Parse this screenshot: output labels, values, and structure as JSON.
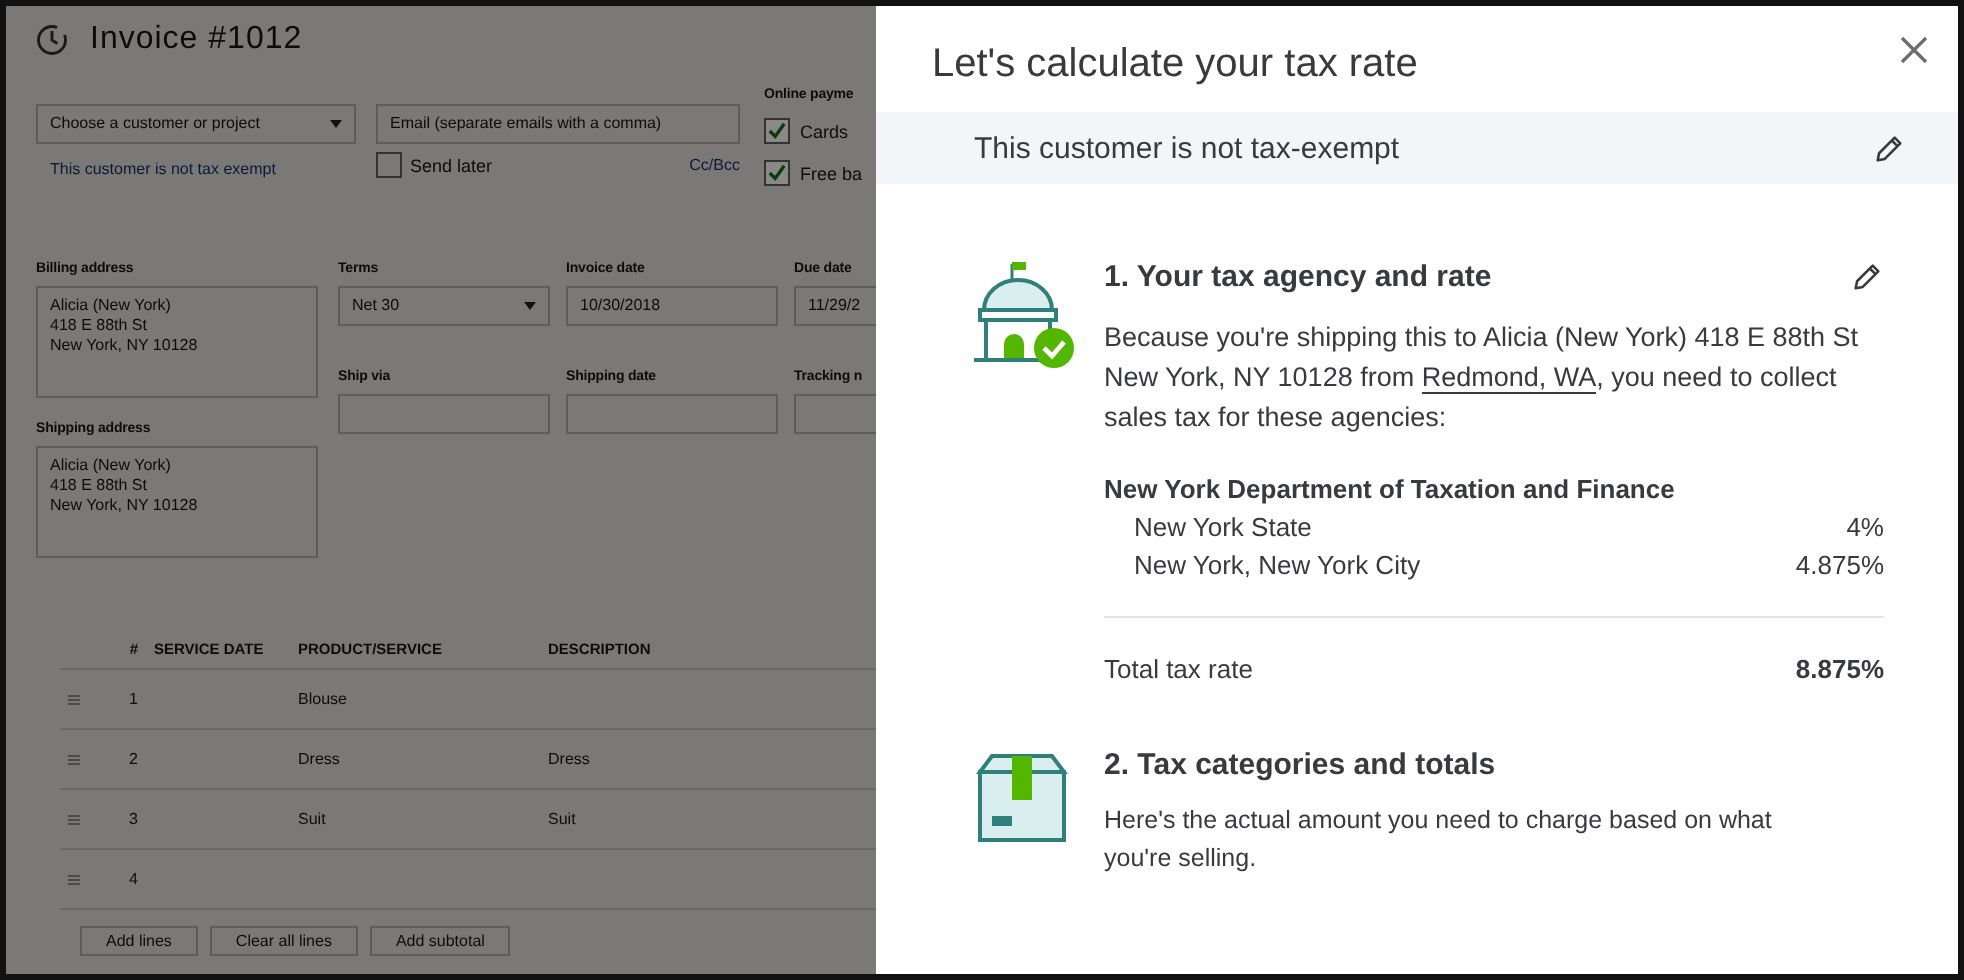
{
  "invoice": {
    "title": "Invoice #1012",
    "customer": {
      "placeholder": "Choose a customer or project"
    },
    "email": {
      "placeholder": "Email (separate emails with a comma)"
    },
    "tax_note": "This customer is not tax exempt",
    "send_later": {
      "label": "Send later",
      "checked": false
    },
    "cc_bcc": "Cc/Bcc",
    "online_payments": {
      "label": "Online payme",
      "options": [
        {
          "label": "Cards",
          "checked": true
        },
        {
          "label": "Free ba",
          "checked": true
        }
      ]
    },
    "billing_address": {
      "label": "Billing address",
      "lines": [
        "Alicia (New York)",
        "418 E 88th St",
        "New York, NY  10128"
      ]
    },
    "terms": {
      "label": "Terms",
      "value": "Net 30"
    },
    "invoice_date": {
      "label": "Invoice date",
      "value": "10/30/2018"
    },
    "due_date": {
      "label": "Due date",
      "value": "11/29/2"
    },
    "ship_via": {
      "label": "Ship via"
    },
    "shipping_date": {
      "label": "Shipping date"
    },
    "tracking": {
      "label": "Tracking n"
    },
    "shipping_address": {
      "label": "Shipping address",
      "lines": [
        "Alicia (New York)",
        "418 E 88th St",
        "New York, NY  10128"
      ]
    },
    "table": {
      "columns": [
        "#",
        "SERVICE DATE",
        "PRODUCT/SERVICE",
        "DESCRIPTION"
      ],
      "rows": [
        [
          "1",
          "",
          "Blouse",
          ""
        ],
        [
          "2",
          "",
          "Dress",
          "Dress"
        ],
        [
          "3",
          "",
          "Suit",
          "Suit"
        ],
        [
          "4",
          "",
          "",
          ""
        ]
      ]
    },
    "buttons": [
      "Add lines",
      "Clear all lines",
      "Add subtotal"
    ]
  },
  "panel": {
    "title": "Let's calculate your tax rate",
    "exempt_status": "This customer is not tax-exempt",
    "sections": [
      {
        "kind": "agency",
        "heading": "1. Your tax agency and rate",
        "editable": true,
        "text_before": "Because you're shipping this to Alicia (New York) 418 E 88th St New York, NY 10128 from ",
        "link": "Redmond, WA",
        "text_after": ", you need to collect sales tax for these agencies:",
        "agency": "New York Department of Taxation and Finance",
        "rates": [
          {
            "name": "New York State",
            "rate": "4%"
          },
          {
            "name": "New York, New York City",
            "rate": "4.875%"
          }
        ],
        "total_label": "Total tax rate",
        "total": "8.875%"
      },
      {
        "kind": "categories",
        "heading": "2. Tax categories and totals",
        "editable": false,
        "text": "Here's the actual amount you need to charge based on what you're selling."
      }
    ]
  }
}
